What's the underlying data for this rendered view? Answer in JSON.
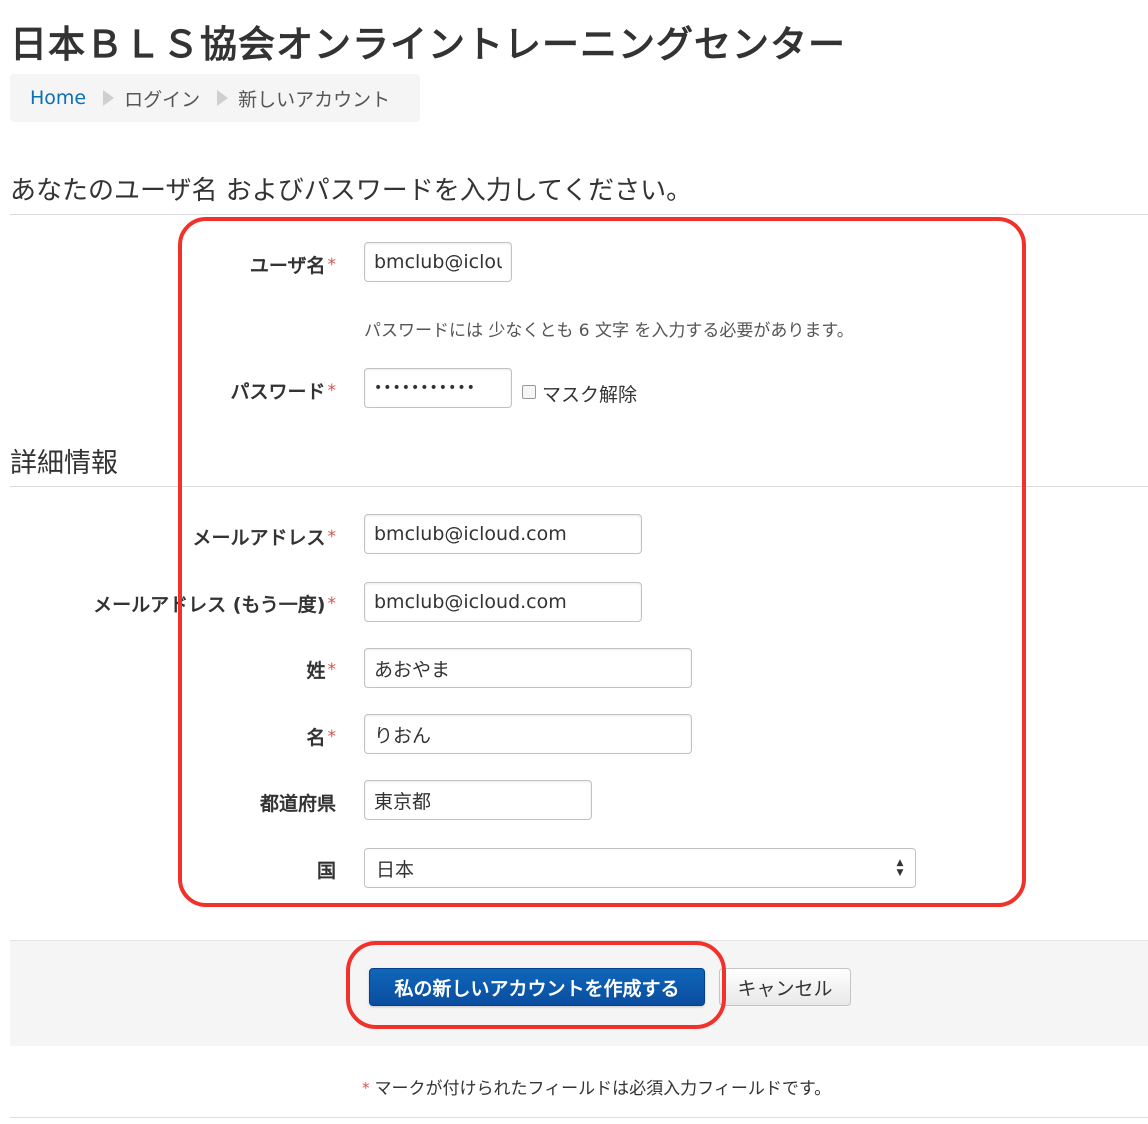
{
  "site": {
    "title": "日本ＢＬＳ協会オンライントレーニングセンター"
  },
  "breadcrumb": {
    "items": [
      "Home",
      "ログイン",
      "新しいアカウント"
    ]
  },
  "login_section": {
    "heading": "あなたのユーザ名 およびパスワードを入力してください。",
    "username_label": "ユーザ名",
    "username_value": "bmclub@icloud.com",
    "password_hint": "パスワードには 少なくとも 6 文字 を入力する必要があります。",
    "password_label": "パスワード",
    "password_value": "•••••••••••",
    "unmask_label": "マスク解除"
  },
  "details_section": {
    "heading": "詳細情報",
    "email_label": "メールアドレス",
    "email_value": "bmclub@icloud.com",
    "email_again_label": "メールアドレス (もう一度)",
    "email_again_value": "bmclub@icloud.com",
    "lastname_label": "姓",
    "lastname_value": "あおやま",
    "firstname_label": "名",
    "firstname_value": "りおん",
    "prefecture_label": "都道府県",
    "prefecture_value": "東京都",
    "country_label": "国",
    "country_value": "日本"
  },
  "required_marker": "*",
  "actions": {
    "create_label": "私の新しいアカウントを作成する",
    "cancel_label": "キャンセル"
  },
  "footnote": {
    "text": "マークが付けられたフィールドは必須入力フィールドです。"
  },
  "colors": {
    "accent": "#0a4da0",
    "required": "#d9534f",
    "highlight": "#f0322b",
    "link": "#0a70b2"
  }
}
